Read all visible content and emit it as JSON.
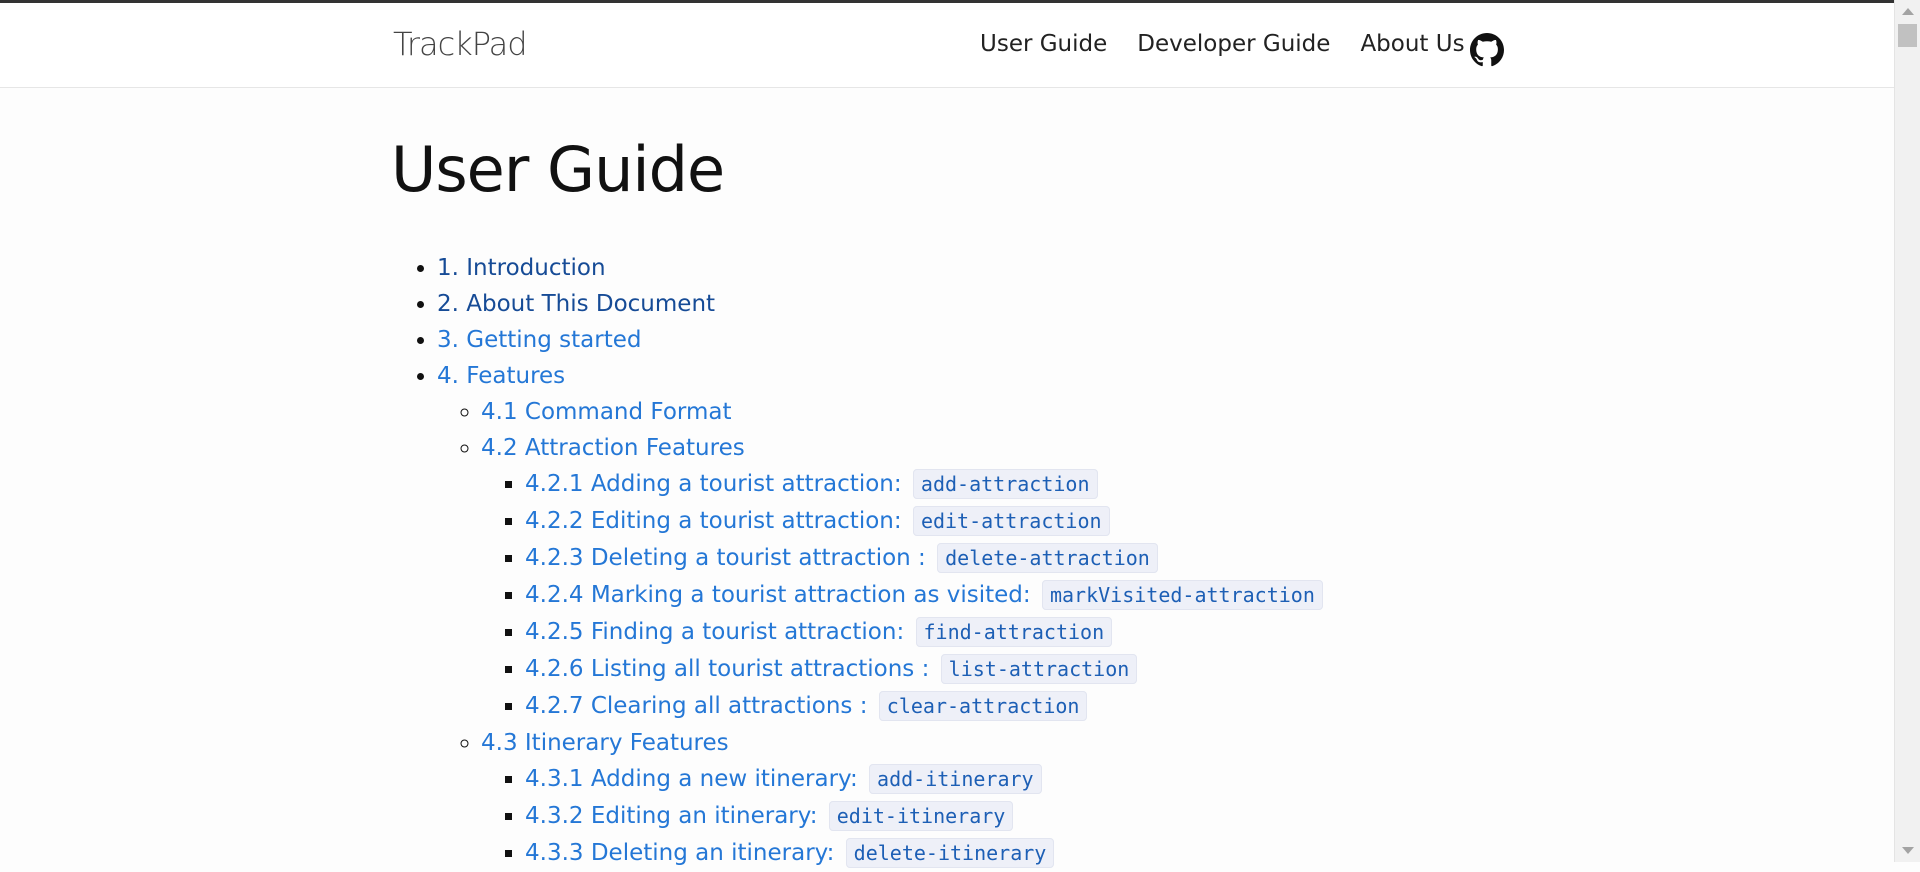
{
  "header": {
    "brand": "TrackPad",
    "nav": [
      "User Guide",
      "Developer Guide",
      "About Us"
    ],
    "github_icon": "github-icon"
  },
  "page": {
    "title": "User Guide"
  },
  "toc": {
    "introduction": "1. Introduction",
    "about_doc": "2. About This Document",
    "getting_started": "3. Getting started",
    "features": "4. Features",
    "command_format": "4.1 Command Format",
    "attraction_features": "4.2 Attraction Features",
    "attraction_items": [
      {
        "label": "4.2.1 Adding a tourist attraction:",
        "cmd": "add-attraction"
      },
      {
        "label": "4.2.2 Editing a tourist attraction:",
        "cmd": "edit-attraction"
      },
      {
        "label": "4.2.3 Deleting a tourist attraction :",
        "cmd": "delete-attraction"
      },
      {
        "label": "4.2.4 Marking a tourist attraction as visited:",
        "cmd": "markVisited-attraction"
      },
      {
        "label": "4.2.5 Finding a tourist attraction:",
        "cmd": "find-attraction"
      },
      {
        "label": "4.2.6 Listing all tourist attractions :",
        "cmd": "list-attraction"
      },
      {
        "label": "4.2.7 Clearing all attractions :",
        "cmd": "clear-attraction"
      }
    ],
    "itinerary_features": "4.3 Itinerary Features",
    "itinerary_items": [
      {
        "label": "4.3.1 Adding a new itinerary:",
        "cmd": "add-itinerary"
      },
      {
        "label": "4.3.2 Editing an itinerary:",
        "cmd": "edit-itinerary"
      },
      {
        "label": "4.3.3 Deleting an itinerary:",
        "cmd": "delete-itinerary"
      }
    ]
  },
  "colors": {
    "link": "#2477d6",
    "link_visited": "#164b96",
    "code_text": "#1d5fb5",
    "code_bg": "#eef0f8"
  }
}
